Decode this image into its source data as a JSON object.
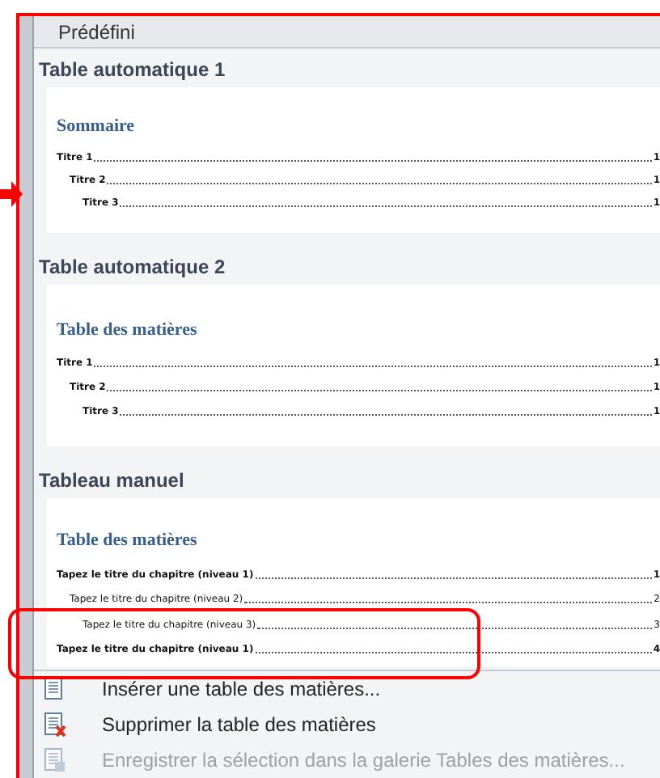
{
  "menu": {
    "title": "Prédéfini",
    "gallery": [
      {
        "title": "Table automatique 1",
        "toc_heading": "Sommaire",
        "entries": [
          {
            "text": "Titre 1",
            "page": "1",
            "children": [
              {
                "text": "Titre 2",
                "page": "1",
                "children": [
                  {
                    "text": "Titre 3",
                    "page": "1"
                  }
                ]
              }
            ]
          }
        ]
      },
      {
        "title": "Table automatique 2",
        "toc_heading": "Table des matières",
        "entries": [
          {
            "text": "Titre 1",
            "page": "1",
            "children": [
              {
                "text": "Titre 2",
                "page": "1",
                "children": [
                  {
                    "text": "Titre 3",
                    "page": "1"
                  }
                ]
              }
            ]
          }
        ]
      },
      {
        "title": "Tableau manuel",
        "toc_heading": "Table des matières",
        "entries": [
          {
            "text": "Tapez le titre du chapitre (niveau 1)",
            "page": "1",
            "children": [
              {
                "text": "Tapez le titre du chapitre (niveau 2)",
                "page": "2",
                "children": [
                  {
                    "text": "Tapez le titre du chapitre (niveau 3)",
                    "page": "3"
                  }
                ]
              }
            ]
          },
          {
            "text": "Tapez le titre du chapitre (niveau 1)",
            "page": "4"
          }
        ]
      }
    ],
    "items": [
      {
        "label": "Insérer une table des matières...",
        "kind": "insert",
        "disabled": false
      },
      {
        "label": "Supprimer la table des matières",
        "kind": "remove",
        "disabled": false
      },
      {
        "label": "Enregistrer la sélection dans la galerie Tables des matières...",
        "kind": "save",
        "disabled": true
      }
    ]
  }
}
